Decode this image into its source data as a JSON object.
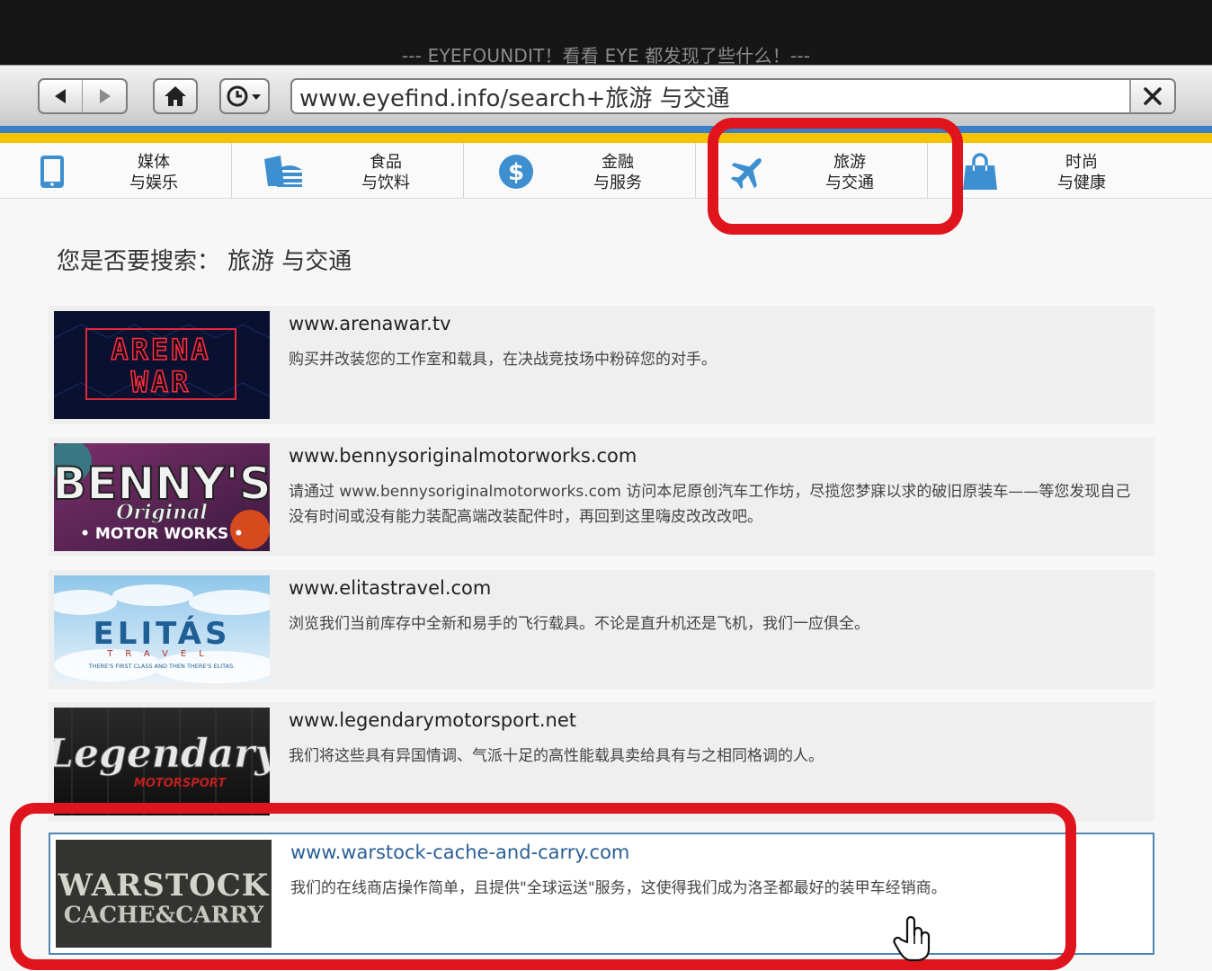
{
  "window": {
    "title": "--- EYEFOUNDIT！看看 EYE 都发现了些什么！---"
  },
  "toolbar": {
    "url": "www.eyefind.info/search+旅游 与交通",
    "back_icon": "back-arrow-icon",
    "forward_icon": "forward-arrow-icon",
    "home_icon": "home-icon",
    "history_icon": "history-clock-icon",
    "close_icon": "close-icon"
  },
  "categories": [
    {
      "line1": "媒体",
      "line2": "与娱乐",
      "icon": "tablet-icon"
    },
    {
      "line1": "食品",
      "line2": "与饮料",
      "icon": "food-icon"
    },
    {
      "line1": "金融",
      "line2": "与服务",
      "icon": "dollar-icon"
    },
    {
      "line1": "旅游",
      "line2": "与交通",
      "icon": "airplane-icon"
    },
    {
      "line1": "时尚",
      "line2": "与健康",
      "icon": "shopping-bag-icon"
    }
  ],
  "search": {
    "prompt": "您是否要搜索：",
    "query": "旅游 与交通"
  },
  "results": [
    {
      "url": "www.arenawar.tv",
      "desc": "购买并改装您的工作室和载具，在决战竞技场中粉碎您的对手。",
      "logo": "ARENA WAR"
    },
    {
      "url": "www.bennysoriginalmotorworks.com",
      "desc": "请通过 www.bennysoriginalmotorworks.com 访问本尼原创汽车工作坊，尽揽您梦寐以求的破旧原装车——等您发现自己没有时间或没有能力装配高端改装配件时，再回到这里嗨皮改改改吧。",
      "logo": "BENNY'S Original MOTOR WORKS"
    },
    {
      "url": "www.elitastravel.com",
      "desc": "浏览我们当前库存中全新和易手的飞行载具。不论是直升机还是飞机，我们一应俱全。",
      "logo": "ELITÁS TRAVEL THERE'S FIRST CLASS AND THEN THERE'S ELITAS."
    },
    {
      "url": "www.legendarymotorsport.net",
      "desc": "我们将这些具有异国情调、气派十足的高性能载具卖给具有与之相同格调的人。",
      "logo": "Legendary MOTORSPORT"
    },
    {
      "url": "www.warstock-cache-and-carry.com",
      "desc": "我们的在线商店操作简单，且提供\"全球运送\"服务，这使得我们成为洛圣都最好的装甲车经销商。",
      "logo": "WARSTOCK CACHE&CARRY"
    }
  ],
  "colors": {
    "accent_blue": "#3a7fc8",
    "accent_yellow": "#f5c400",
    "highlight_red": "#e0141c",
    "icon_blue": "#3d8fd0"
  }
}
